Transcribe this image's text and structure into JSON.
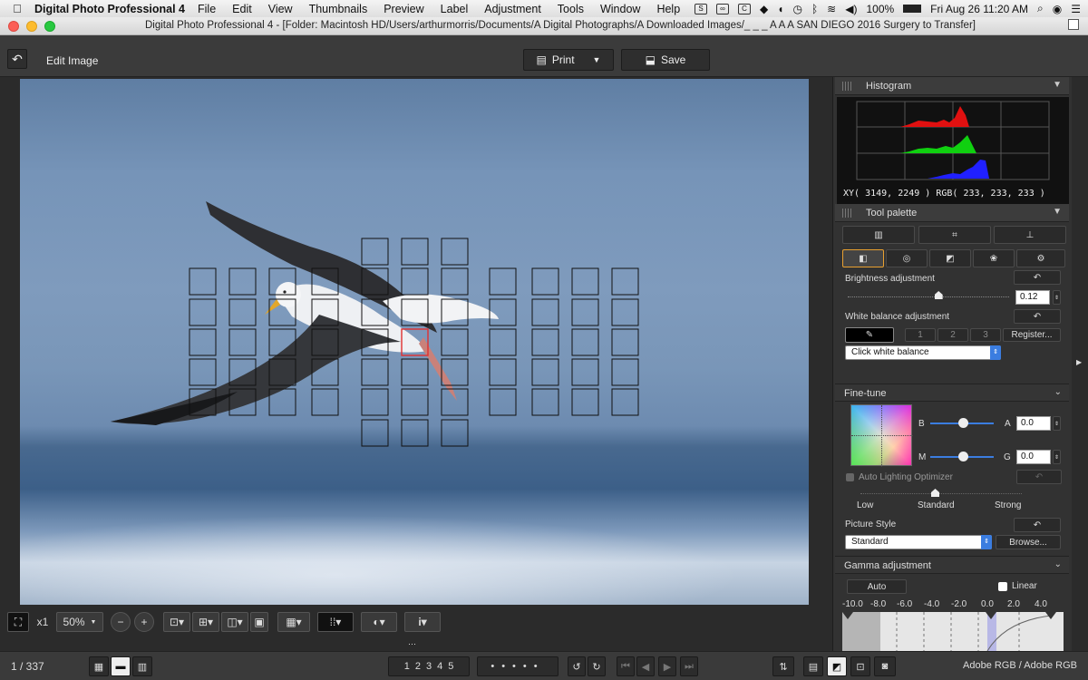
{
  "menubar": {
    "app": "Digital Photo Professional 4",
    "items": [
      "File",
      "Edit",
      "View",
      "Thumbnails",
      "Preview",
      "Label",
      "Adjustment",
      "Tools",
      "Window",
      "Help"
    ],
    "battery": "100%",
    "clock": "Fri Aug 26  11:20 AM"
  },
  "window": {
    "title": "Digital Photo Professional 4 - [Folder: Macintosh HD/Users/arthurmorris/Documents/A Digital Photographs/A Downloaded Images/_ _ _ A A A SAN DIEGO 2016 Surgery to Transfer]"
  },
  "toolbar": {
    "edit_label": "Edit Image",
    "print_label": "Print",
    "save_label": "Save"
  },
  "viewer": {
    "zoom_x": "x1",
    "zoom_value": "50%"
  },
  "status": {
    "frame_count": "1 / 337",
    "color_space": "Adobe RGB / Adobe RGB",
    "ratings": [
      "1",
      "2",
      "3",
      "4",
      "5"
    ]
  },
  "histogram": {
    "title": "Histogram",
    "readout": "XY(  3149,   2249 ) RGB( 233,  233,  233 )"
  },
  "tool_palette": {
    "title": "Tool palette",
    "brightness": {
      "label": "Brightness adjustment",
      "value": "0.12",
      "level_fraction": 0.56
    },
    "white_balance": {
      "label": "White balance adjustment",
      "presets": [
        "1",
        "2",
        "3"
      ],
      "register_label": "Register...",
      "dropdown": "Click white balance"
    },
    "fine_tune": {
      "label": "Fine-tune",
      "b_label": "B",
      "a_label": "A",
      "a_value": "0.0",
      "m_label": "M",
      "g_label": "G",
      "g_value": "0.0"
    },
    "alo": {
      "label": "Auto Lighting Optimizer",
      "levels": [
        "Low",
        "Standard",
        "Strong"
      ]
    },
    "picture_style": {
      "label": "Picture Style",
      "value": "Standard",
      "browse_label": "Browse..."
    },
    "gamma": {
      "label": "Gamma adjustment",
      "auto_label": "Auto",
      "linear_label": "Linear",
      "ticks": [
        "-10.0",
        "-8.0",
        "-6.0",
        "-4.0",
        "-2.0",
        "0.0",
        "2.0",
        "4.0"
      ]
    }
  },
  "colors": {
    "af_point_active": "#e03030",
    "accent_select": "#3b7de0",
    "panel_bg": "#323232"
  }
}
